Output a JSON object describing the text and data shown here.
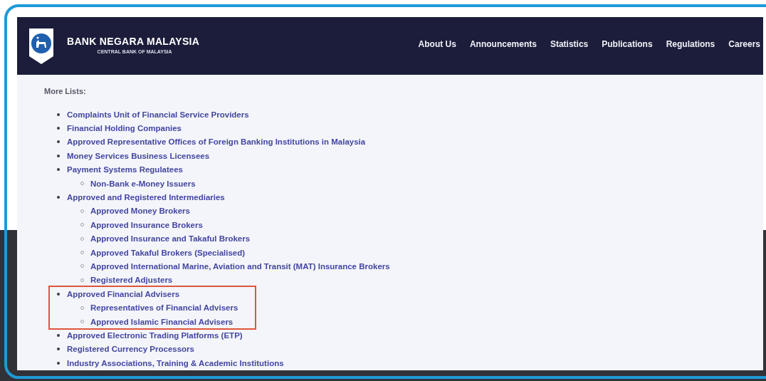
{
  "header": {
    "brand": "BANK NEGARA MALAYSIA",
    "tagline": "CENTRAL BANK OF MALAYSIA",
    "nav": [
      "About Us",
      "Announcements",
      "Statistics",
      "Publications",
      "Regulations",
      "Careers"
    ]
  },
  "section_title": "More Lists:",
  "lists": [
    {
      "label": "Complaints Unit of Financial Service Providers",
      "highlighted": false
    },
    {
      "label": "Financial Holding Companies",
      "highlighted": false
    },
    {
      "label": "Approved Representative Offices of Foreign Banking Institutions in Malaysia",
      "highlighted": false
    },
    {
      "label": "Money Services Business Licensees",
      "highlighted": false
    },
    {
      "label": "Payment Systems Regulatees",
      "highlighted": false,
      "children": [
        {
          "label": "Non-Bank e-Money Issuers"
        }
      ]
    },
    {
      "label": "Approved and Registered Intermediaries",
      "highlighted": false,
      "children": [
        {
          "label": "Approved Money Brokers"
        },
        {
          "label": "Approved Insurance Brokers"
        },
        {
          "label": "Approved Insurance and Takaful Brokers"
        },
        {
          "label": "Approved Takaful Brokers (Specialised)"
        },
        {
          "label": "Approved International Marine, Aviation and Transit (MAT) Insurance Brokers"
        },
        {
          "label": "Registered Adjusters"
        }
      ]
    },
    {
      "label": "Approved Financial Advisers",
      "highlighted": true,
      "children": [
        {
          "label": "Representatives of Financial Advisers"
        },
        {
          "label": "Approved Islamic Financial Advisers"
        }
      ]
    },
    {
      "label": "Approved Electronic Trading Platforms (ETP)",
      "highlighted": false
    },
    {
      "label": "Registered Currency Processors",
      "highlighted": false
    },
    {
      "label": "Industry Associations, Training & Academic Institutions",
      "highlighted": false
    }
  ]
}
